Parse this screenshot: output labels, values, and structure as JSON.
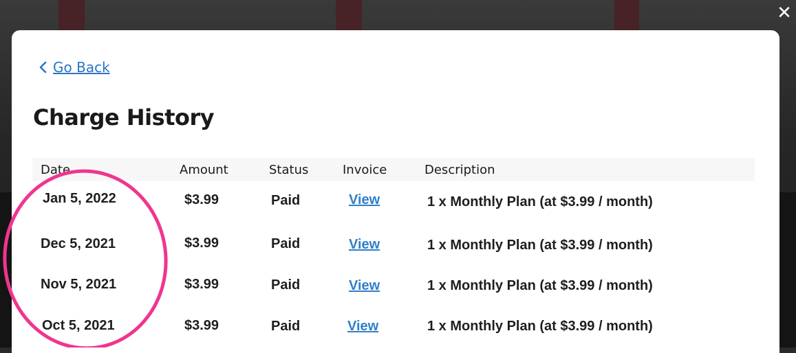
{
  "modal": {
    "close_icon": "close-icon",
    "go_back_label": "Go Back",
    "title": "Charge History"
  },
  "table": {
    "headers": [
      "Date",
      "Amount",
      "Status",
      "Invoice",
      "Description"
    ],
    "rows": [
      {
        "date": "Jan 5, 2022",
        "amount": "$3.99",
        "status": "Paid",
        "invoice": "View",
        "description": "1 x Monthly Plan (at $3.99 / month)"
      },
      {
        "date": "Dec 5, 2021",
        "amount": "$3.99",
        "status": "Paid",
        "invoice": "View",
        "description": "1 x Monthly Plan (at $3.99 / month)"
      },
      {
        "date": "Nov 5, 2021",
        "amount": "$3.99",
        "status": "Paid",
        "invoice": "View",
        "description": "1 x Monthly Plan (at $3.99 / month)"
      },
      {
        "date": "Oct 5, 2021",
        "amount": "$3.99",
        "status": "Paid",
        "invoice": "View",
        "description": "1 x Monthly Plan (at $3.99 / month)"
      }
    ]
  },
  "colors": {
    "link": "#2f7fc9",
    "annotation": "#f0358f"
  }
}
